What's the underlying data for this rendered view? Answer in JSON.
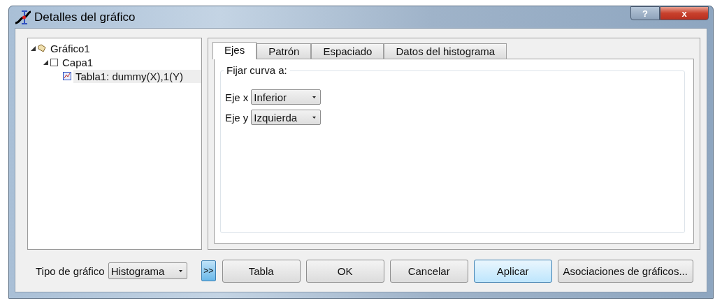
{
  "window": {
    "title": "Detalles del gráfico",
    "title_buttons": [
      {
        "kind": "help",
        "label": "?"
      },
      {
        "kind": "close",
        "label": "x"
      }
    ]
  },
  "tree": [
    {
      "label": "Gráfico1",
      "kind": "graph",
      "expanded": true,
      "selected": false,
      "children": [
        {
          "label": "Capa1",
          "kind": "layer",
          "expanded": true,
          "selected": false,
          "children": [
            {
              "label": "Tabla1: dummy(X),1(Y)",
              "kind": "curve",
              "selected": true
            }
          ]
        }
      ]
    }
  ],
  "tabs": [
    {
      "label": "Ejes",
      "selected": true
    },
    {
      "label": "Patrón",
      "selected": false
    },
    {
      "label": "Espaciado",
      "selected": false
    },
    {
      "label": "Datos del histograma",
      "selected": false
    }
  ],
  "group": {
    "title": "Fijar curva a:",
    "rows": [
      {
        "label": "Eje x",
        "value": "Inferior"
      },
      {
        "label": "Eje y",
        "value": "Izquierda"
      }
    ]
  },
  "chart_type": {
    "label": "Tipo de gráfico",
    "value": "Histograma"
  },
  "toggle": {
    "label": ">>",
    "on": true
  },
  "buttons": [
    {
      "label": "Tabla",
      "default": false
    },
    {
      "label": "OK",
      "default": false
    },
    {
      "label": "Cancelar",
      "default": false
    },
    {
      "label": "Aplicar",
      "default": true
    },
    {
      "label": "Asociaciones de gráficos...",
      "default": false
    }
  ]
}
